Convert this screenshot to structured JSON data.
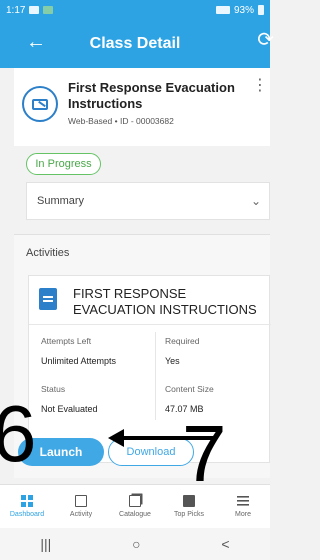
{
  "status_bar": {
    "time": "1:17",
    "battery": "93%"
  },
  "header": {
    "title": "Class Detail"
  },
  "course": {
    "title": "First Response Evacuation Instructions",
    "meta": "Web-Based • ID - 00003682"
  },
  "status_pill": "In Progress",
  "summary": {
    "label": "Summary"
  },
  "activities": {
    "label": "Activities",
    "item": {
      "title": "FIRST RESPONSE EVACUATION INSTRUCTIONS",
      "attempts_left_label": "Attempts Left",
      "attempts_left_value": "Unlimited Attempts",
      "required_label": "Required",
      "required_value": "Yes",
      "status_label": "Status",
      "status_value": "Not Evaluated",
      "content_size_label": "Content Size",
      "content_size_value": "47.07 MB"
    },
    "buttons": {
      "launch": "Launch",
      "download": "Download"
    }
  },
  "overlays": {
    "left_number": "6",
    "right_number": "7"
  },
  "bottom_nav": {
    "items": [
      {
        "label": "Dashboard",
        "icon": "dashboard-icon"
      },
      {
        "label": "Activity",
        "icon": "activity-icon"
      },
      {
        "label": "Catalogue",
        "icon": "catalogue-icon"
      },
      {
        "label": "Top Picks",
        "icon": "top-picks-icon"
      },
      {
        "label": "More",
        "icon": "more-icon"
      }
    ]
  },
  "android_nav": {
    "recents": "|||",
    "home": "○",
    "back": "<"
  }
}
